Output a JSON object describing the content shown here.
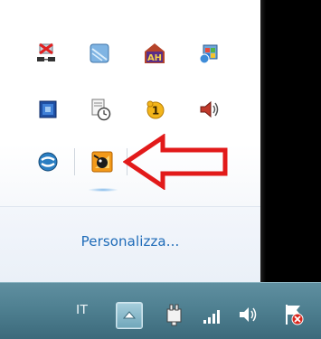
{
  "panel": {
    "customize_link": "Personalizza...",
    "icons_row1": [
      "network-disconnected-icon",
      "window-app-icon",
      "ah-app-icon",
      "windows-update-icon"
    ],
    "icons_row2": [
      "blue-app-icon",
      "document-clock-icon",
      "notification-badge-icon",
      "volume-speaker-icon"
    ],
    "icons_row3": [
      "sync-circle-icon",
      "hamster-app-icon"
    ],
    "badge_count": "1",
    "ah_label": "AH"
  },
  "taskbar": {
    "language": "IT",
    "tray": [
      "show-hidden-icons-button",
      "power-plug-icon",
      "signal-bars-icon",
      "volume-icon",
      "action-center-flag-icon"
    ]
  },
  "colors": {
    "annotation_arrow": "#e21a1a",
    "link": "#1e6bb8",
    "taskbar": "#4f8091"
  }
}
